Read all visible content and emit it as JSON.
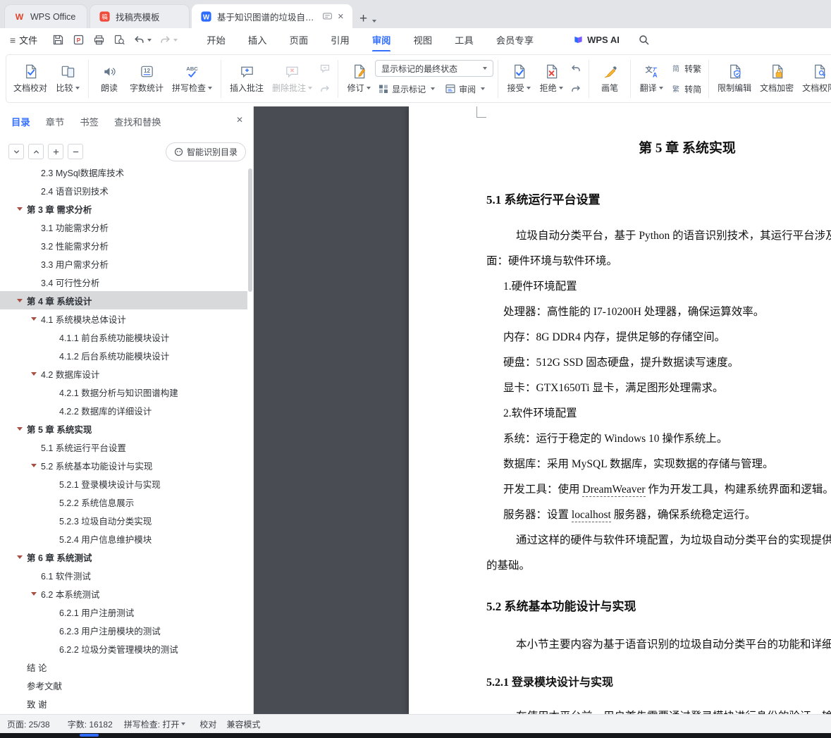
{
  "tabbar": {
    "tab1": "WPS Office",
    "tab2": "找稿壳模板",
    "tab3": "基于知识图谱的垃圾自动分类",
    "new_tab": "+"
  },
  "menubar": {
    "file": "文件",
    "items": [
      "开始",
      "插入",
      "页面",
      "引用",
      "审阅",
      "视图",
      "工具",
      "会员专享"
    ],
    "wps_ai": "WPS AI"
  },
  "ribbon": {
    "doc_proof": "文档校对",
    "compare": "比较",
    "read": "朗读",
    "word_count": "字数统计",
    "spell_check": "拼写检查",
    "insert_comment": "插入批注",
    "delete_comment": "删除批注",
    "revise": "修订",
    "marks_state": "显示标记的最终状态",
    "show_marks": "显示标记",
    "review_pane": "审阅",
    "accept": "接受",
    "reject": "拒绝",
    "pen": "画笔",
    "translate": "翻译",
    "to_trad": "转繁",
    "to_simp": "转简",
    "restrict": "限制编辑",
    "encrypt": "文档加密",
    "perm": "文档权限"
  },
  "sidebar": {
    "tabs": [
      "目录",
      "章节",
      "书签",
      "查找和替换"
    ],
    "smart_btn": "智能识别目录",
    "toc": [
      "2.3 MySql数据库技术",
      "2.4 语音识别技术",
      "第 3 章  需求分析",
      "3.1 功能需求分析",
      "3.2 性能需求分析",
      "3.3 用户需求分析",
      "3.4 可行性分析",
      "第 4 章 系统设计",
      "4.1 系统模块总体设计",
      "4.1.1 前台系统功能模块设计",
      "4.1.2 后台系统功能模块设计",
      "4.2 数据库设计",
      "4.2.1 数据分析与知识图谱构建",
      "4.2.2 数据库的详细设计",
      "第 5 章 系统实现",
      "5.1 系统运行平台设置",
      "5.2 系统基本功能设计与实现",
      "5.2.1 登录模块设计与实现",
      "5.2.2 系统信息展示",
      "5.2.3 垃圾自动分类实现",
      "5.2.4 用户信息维护模块",
      "第 6 章  系统测试",
      "6.1 软件测试",
      "6.2 本系统测试",
      "6.2.1 用户注册测试",
      "6.2.3 用户注册模块的测试",
      "6.2.2 垃圾分类管理模块的测试",
      "结  论",
      "参考文献",
      "致  谢"
    ]
  },
  "doc": {
    "title": "第 5 章  系统实现",
    "h51": "5.1  系统运行平台设置",
    "p1a": "垃圾自动分类平台，基于 Python 的语音识别技术，其运行平台涉及两个方",
    "p1b": "面：硬件环境与软件环境。",
    "hw_head": "1.硬件环境配置",
    "hw1": "处理器：高性能的 I7-10200H 处理器，确保运算效率。",
    "hw2": "内存：8G DDR4 内存，提供足够的存储空间。",
    "hw3": "硬盘：512G SSD 固态硬盘，提升数据读写速度。",
    "hw4": "显卡：GTX1650Ti 显卡，满足图形处理需求。",
    "sw_head": "2.软件环境配置",
    "sw1": "系统：运行于稳定的 Windows 10 操作系统上。",
    "sw2": "数据库：采用 MySQL 数据库，实现数据的存储与管理。",
    "sw3_pre": "开发工具：使用 ",
    "sw3_u": "DreamWeaver",
    "sw3_post": " 作为开发工具，构建系统界面和逻辑。",
    "sw4_pre": "服务器：设置 ",
    "sw4_u": "localhost",
    "sw4_post": " 服务器，确保系统稳定运行。",
    "p2a": "通过这样的硬件与软件环境配置，为垃圾自动分类平台的实现提供了坚实",
    "p2b": "的基础。",
    "h52": "5.2  系统基本功能设计与实现",
    "p3": "本小节主要内容为基于语音识别的垃圾自动分类平台的功能和详细设计与实现。",
    "h521": "5.2.1  登录模块设计与实现",
    "p4": "在使用本平台前，用户首先需要通过登录模块进行身份的验证，输入正确的"
  },
  "statusbar": {
    "page": "页面: 25/38",
    "words": "字数: 16182",
    "spell": "拼写检查: 打开",
    "proof": "校对",
    "mode": "兼容模式"
  }
}
